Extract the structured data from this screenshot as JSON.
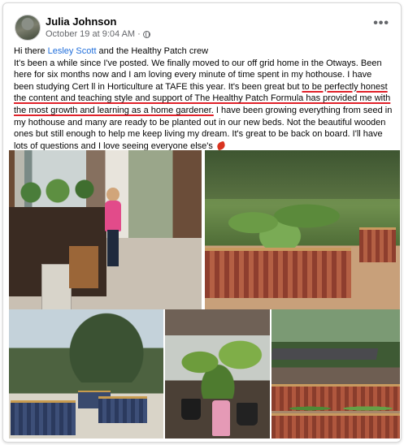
{
  "post": {
    "author": "Julia Johnson",
    "timestamp": "October 19 at 9:04 AM",
    "separator": "·",
    "more_label": "•••",
    "greeting_pre": "Hi there ",
    "mention": "Lesley Scott",
    "greeting_post": " and the Healthy Patch crew",
    "body_1": "It's been a while since I've posted.  We finally moved to our off grid home in the Otways. Been here for six months now and I am loving every minute of time spent in my hothouse. I have been studying Cert ll in Horticulture at TAFE this year. It's been great but ",
    "body_highlight": "to be perfectly honest the content and teaching style and support of The Healthy Patch Formula has provided me with the most growth and learning as a home gardener.",
    "body_2": "  I have been growing everything from seed in my hothouse and many are ready to be planted out in our new beds. Not the beautiful wooden ones but still enough to help me keep living my dream. It's great to be back on board. I'll have lots of questions and I love seeing everyone else's "
  },
  "icons": {
    "avatar": "avatar",
    "privacy": "globe-icon",
    "more": "more-options-icon",
    "emoji": "maple-leaf-icon"
  },
  "colors": {
    "mention": "#216fdb",
    "highlight_underline": "#e0222a",
    "meta_text": "#65676b"
  }
}
